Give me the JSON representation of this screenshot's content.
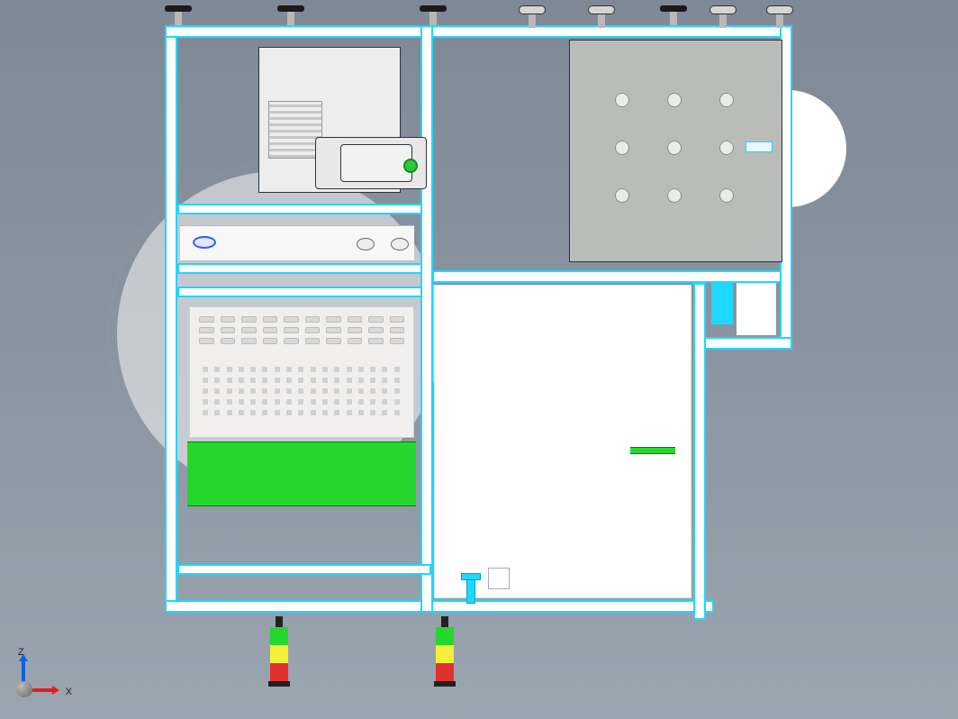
{
  "axis": {
    "x_label": "X",
    "z_label": "Z"
  },
  "colors": {
    "frame": "#1fd8ff",
    "green": "#25d72c",
    "cabinet": "#b9bcb9",
    "bg_top": "#7f8995",
    "bg_bottom": "#9ba5b0"
  },
  "components": {
    "top_feet_x": [
      195,
      320,
      478,
      588,
      665,
      745,
      800,
      863
    ],
    "stacklights_x": [
      306,
      490
    ],
    "cabinet_holes": {
      "cols": [
        692,
        750,
        808
      ],
      "rows": [
        112,
        165,
        218
      ]
    }
  }
}
